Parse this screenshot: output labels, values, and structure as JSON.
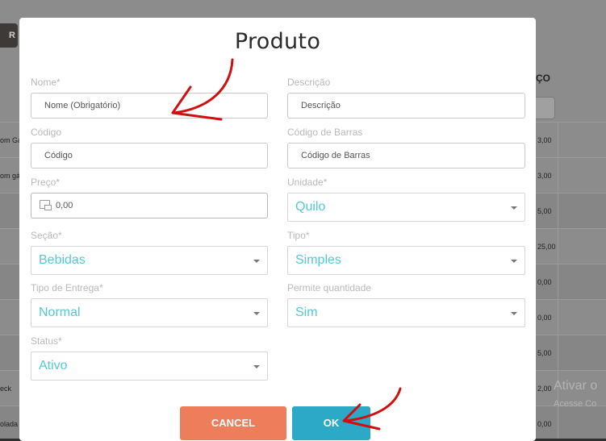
{
  "background": {
    "left_button_label": "R",
    "column_header": "ÇO",
    "rows_left": [
      "om Ga",
      "om gá",
      "",
      "",
      "",
      "",
      "",
      "eck",
      "olada"
    ],
    "rows_right": [
      "3,00",
      "3,00",
      "5,00",
      "25,00",
      "0,00",
      "0,00",
      "5,00",
      "2,00",
      "0,00"
    ],
    "watermark_title": "Ativar o",
    "watermark_sub": "Acesse Co"
  },
  "modal": {
    "title": "Produto",
    "fields": {
      "nome": {
        "label": "Nome*",
        "placeholder": "Nome (Obrigatório)"
      },
      "descricao": {
        "label": "Descrição",
        "placeholder": "Descrição"
      },
      "codigo": {
        "label": "Código",
        "placeholder": "Código"
      },
      "codigo_barras": {
        "label": "Código de Barras",
        "placeholder": "Código de Barras"
      },
      "preco": {
        "label": "Preço*",
        "value": "0,00"
      },
      "unidade": {
        "label": "Unidade*",
        "value": "Quilo"
      },
      "secao": {
        "label": "Seção*",
        "value": "Bebidas"
      },
      "tipo": {
        "label": "Tipo*",
        "value": "Simples"
      },
      "tipo_entrega": {
        "label": "Tipo de Entrega*",
        "value": "Normal"
      },
      "permite_quantidade": {
        "label": "Permite quantidade",
        "value": "Sim"
      },
      "status": {
        "label": "Status*",
        "value": "Ativo"
      }
    },
    "buttons": {
      "cancel": "CANCEL",
      "ok": "OK"
    }
  },
  "colors": {
    "cancel": "#ee7d5c",
    "ok": "#2ca9c7",
    "select_text": "#55c8d6",
    "annotation_arrow": "#d01010"
  }
}
